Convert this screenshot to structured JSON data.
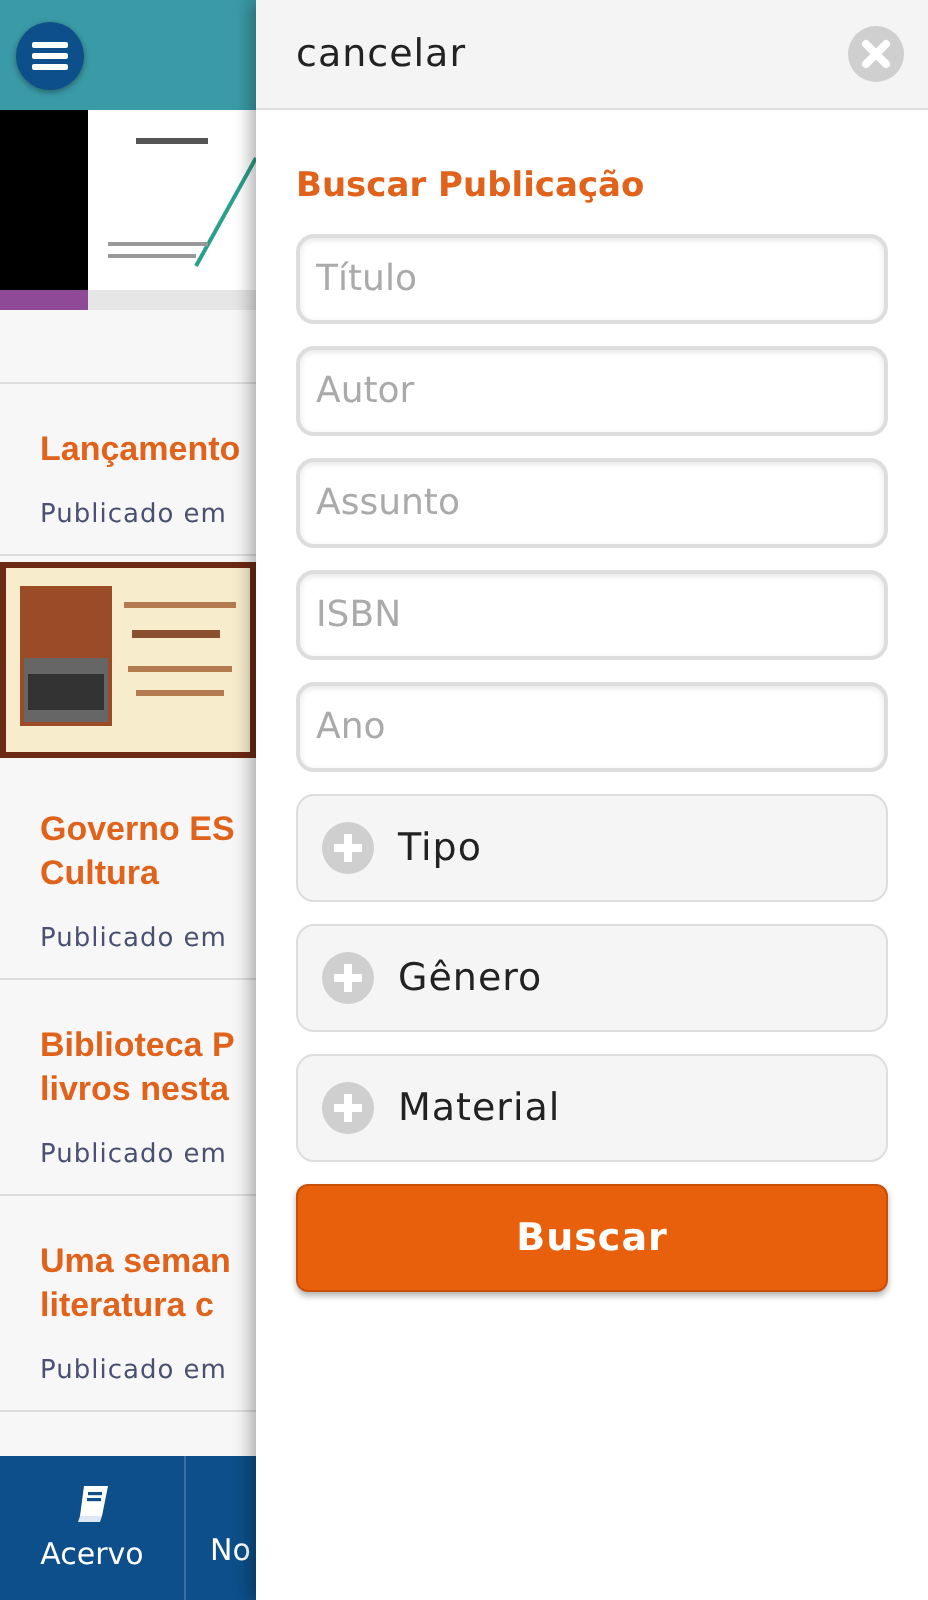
{
  "news": [
    {
      "kind": "banner"
    },
    {
      "kind": "article",
      "title": [
        "Lançamento"
      ],
      "meta": "Publicado em"
    },
    {
      "kind": "flyer"
    },
    {
      "kind": "article",
      "title": [
        "Governo ES",
        "Cultura"
      ],
      "meta": "Publicado em"
    },
    {
      "kind": "article",
      "title": [
        "Biblioteca P",
        "livros nesta"
      ],
      "meta": "Publicado em"
    },
    {
      "kind": "article",
      "title": [
        "Uma seman",
        "literatura c"
      ],
      "meta": "Publicado em"
    }
  ],
  "bottom_nav": [
    {
      "label": "Acervo"
    },
    {
      "label": "No"
    }
  ],
  "search_panel": {
    "cancel": "cancelar",
    "title": "Buscar Publicação",
    "fields": [
      {
        "placeholder": "Título"
      },
      {
        "placeholder": "Autor"
      },
      {
        "placeholder": "Assunto"
      },
      {
        "placeholder": "ISBN"
      },
      {
        "placeholder": "Ano"
      }
    ],
    "filters": [
      {
        "label": "Tipo",
        "expanded": false
      },
      {
        "label": "Gênero",
        "expanded": false
      },
      {
        "label": "Material",
        "expanded": false
      }
    ],
    "submit": "Buscar"
  }
}
